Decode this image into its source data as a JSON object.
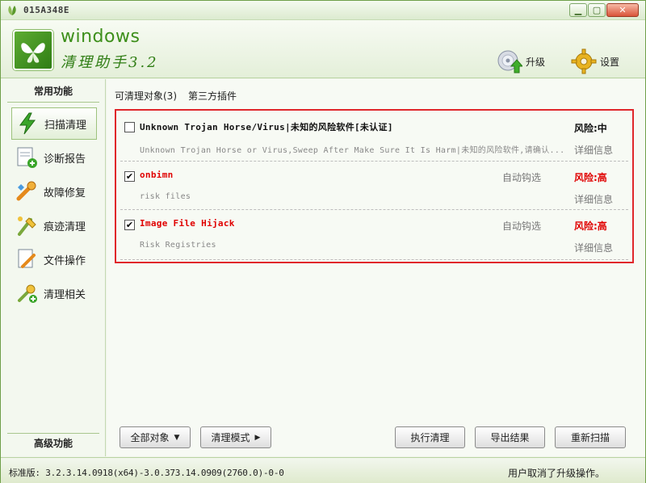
{
  "window": {
    "title": "015A348E",
    "min": "▁",
    "max": "▢",
    "close": "✕"
  },
  "header": {
    "brand_en": "windows",
    "brand_cn": "清理助手3.2",
    "upgrade_label": "升级",
    "settings_label": "设置"
  },
  "sidebar": {
    "common_head": "常用功能",
    "advanced_head": "高级功能",
    "items": [
      {
        "label": "扫描清理",
        "icon": "scan-bolt-icon"
      },
      {
        "label": "诊断报告",
        "icon": "report-icon"
      },
      {
        "label": "故障修复",
        "icon": "repair-icon"
      },
      {
        "label": "痕迹清理",
        "icon": "trace-clean-icon"
      },
      {
        "label": "文件操作",
        "icon": "file-op-icon"
      },
      {
        "label": "清理相关",
        "icon": "clean-related-icon"
      }
    ]
  },
  "tabs": {
    "objects": "可清理对象(3)",
    "plugins": "第三方插件"
  },
  "results": [
    {
      "checked": false,
      "title": "Unknown Trojan Horse/Virus|未知的风险软件[未认证]",
      "desc": "Unknown Trojan Horse or Virus,Sweep After Make Sure It Is Harm|未知的风险软件,请确认...",
      "auto": "",
      "risk": "风险:中",
      "detail": "详细信息"
    },
    {
      "checked": true,
      "title": "onbimn",
      "desc": "risk files",
      "auto": "自动钩选",
      "risk": "风险:高",
      "detail": "详细信息"
    },
    {
      "checked": true,
      "title": "Image File Hijack",
      "desc": "Risk Registries",
      "auto": "自动钩选",
      "risk": "风险:高",
      "detail": "详细信息"
    }
  ],
  "buttons": {
    "all": "全部对象",
    "mode": "清理模式",
    "exec": "执行清理",
    "export": "导出结果",
    "rescan": "重新扫描"
  },
  "status": {
    "version": "标准版: 3.2.3.14.0918(x64)-3.0.373.14.0909(2760.0)-0-0",
    "message": "用户取消了升级操作。"
  },
  "colors": {
    "accent": "#3d8f1b",
    "highlight_border": "#e0272b",
    "risk_high": "#e00000"
  }
}
